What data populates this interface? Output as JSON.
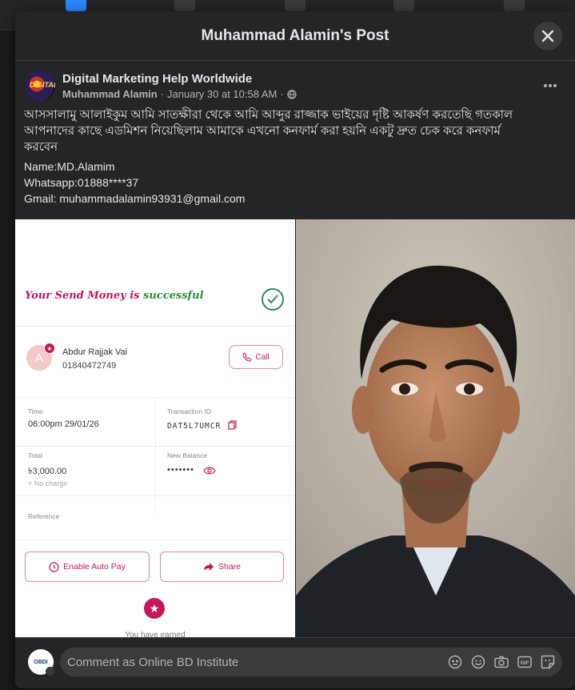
{
  "modal": {
    "title": "Muhammad Alamin's Post"
  },
  "post": {
    "page_name": "Digital Marketing Help Worldwide",
    "page_avatar_text": "DIGITAL",
    "author": "Muhammad Alamin",
    "separator": "·",
    "date": "January 30 at 10:58 AM",
    "privacy_separator": "·",
    "text_lines": [
      "আসসালামু আলাইকুম আমি সাতক্ষীরা থেকে আমি আব্দুর রাজ্জাক ভাইয়ের দৃষ্টি আকর্ষণ করতেছি গতকাল",
      "আপনাদের কাছে এডমিশন নিয়েছিলাম আমাকে এখনো কনফার্ম করা হয়নি একটু দ্রুত চেক করে কনফার্ম",
      "করবেন"
    ],
    "details": [
      "Name:MD.Alamim",
      "Whatsapp:01888****37",
      "Gmail: muhammadalamin93931@gmail.com"
    ]
  },
  "receipt": {
    "success_prefix": "Your Send Money is ",
    "success_word": "successful",
    "avatar_letter": "A",
    "recipient_name": "Abdur Rajjak Vai",
    "recipient_phone": "01840472749",
    "call_label": "Call",
    "time_label": "Time",
    "time_value": "06:00pm 29/01/26",
    "txid_label": "Transaction ID",
    "txid_value": "DAT5L7UMCR",
    "total_label": "Total",
    "total_value": "৳3,000.00",
    "charge_note": "+ No charge",
    "balance_label": "New Balance",
    "balance_value": "•••••••",
    "reference_label": "Reference",
    "autopay_label": "Enable Auto Pay",
    "share_label": "Share",
    "earned_text": "You have earned"
  },
  "comment": {
    "avatar_text": "OBDI",
    "placeholder": "Comment as Online BD Institute"
  },
  "colors": {
    "modal_bg": "#242526",
    "page_bg": "#18191a",
    "input_bg": "#3a3b3c",
    "text_primary": "#e4e6eb",
    "text_secondary": "#b0b3b8",
    "receipt_accent": "#c2185b"
  },
  "icons": [
    "close-icon",
    "more-icon",
    "globe-icon",
    "check-circle-icon",
    "phone-icon",
    "copy-icon",
    "eye-icon",
    "autopay-icon",
    "share-arrow-icon",
    "star-icon",
    "avatar-sticker-icon",
    "emoji-icon",
    "camera-icon",
    "gif-icon",
    "sticker-icon"
  ]
}
